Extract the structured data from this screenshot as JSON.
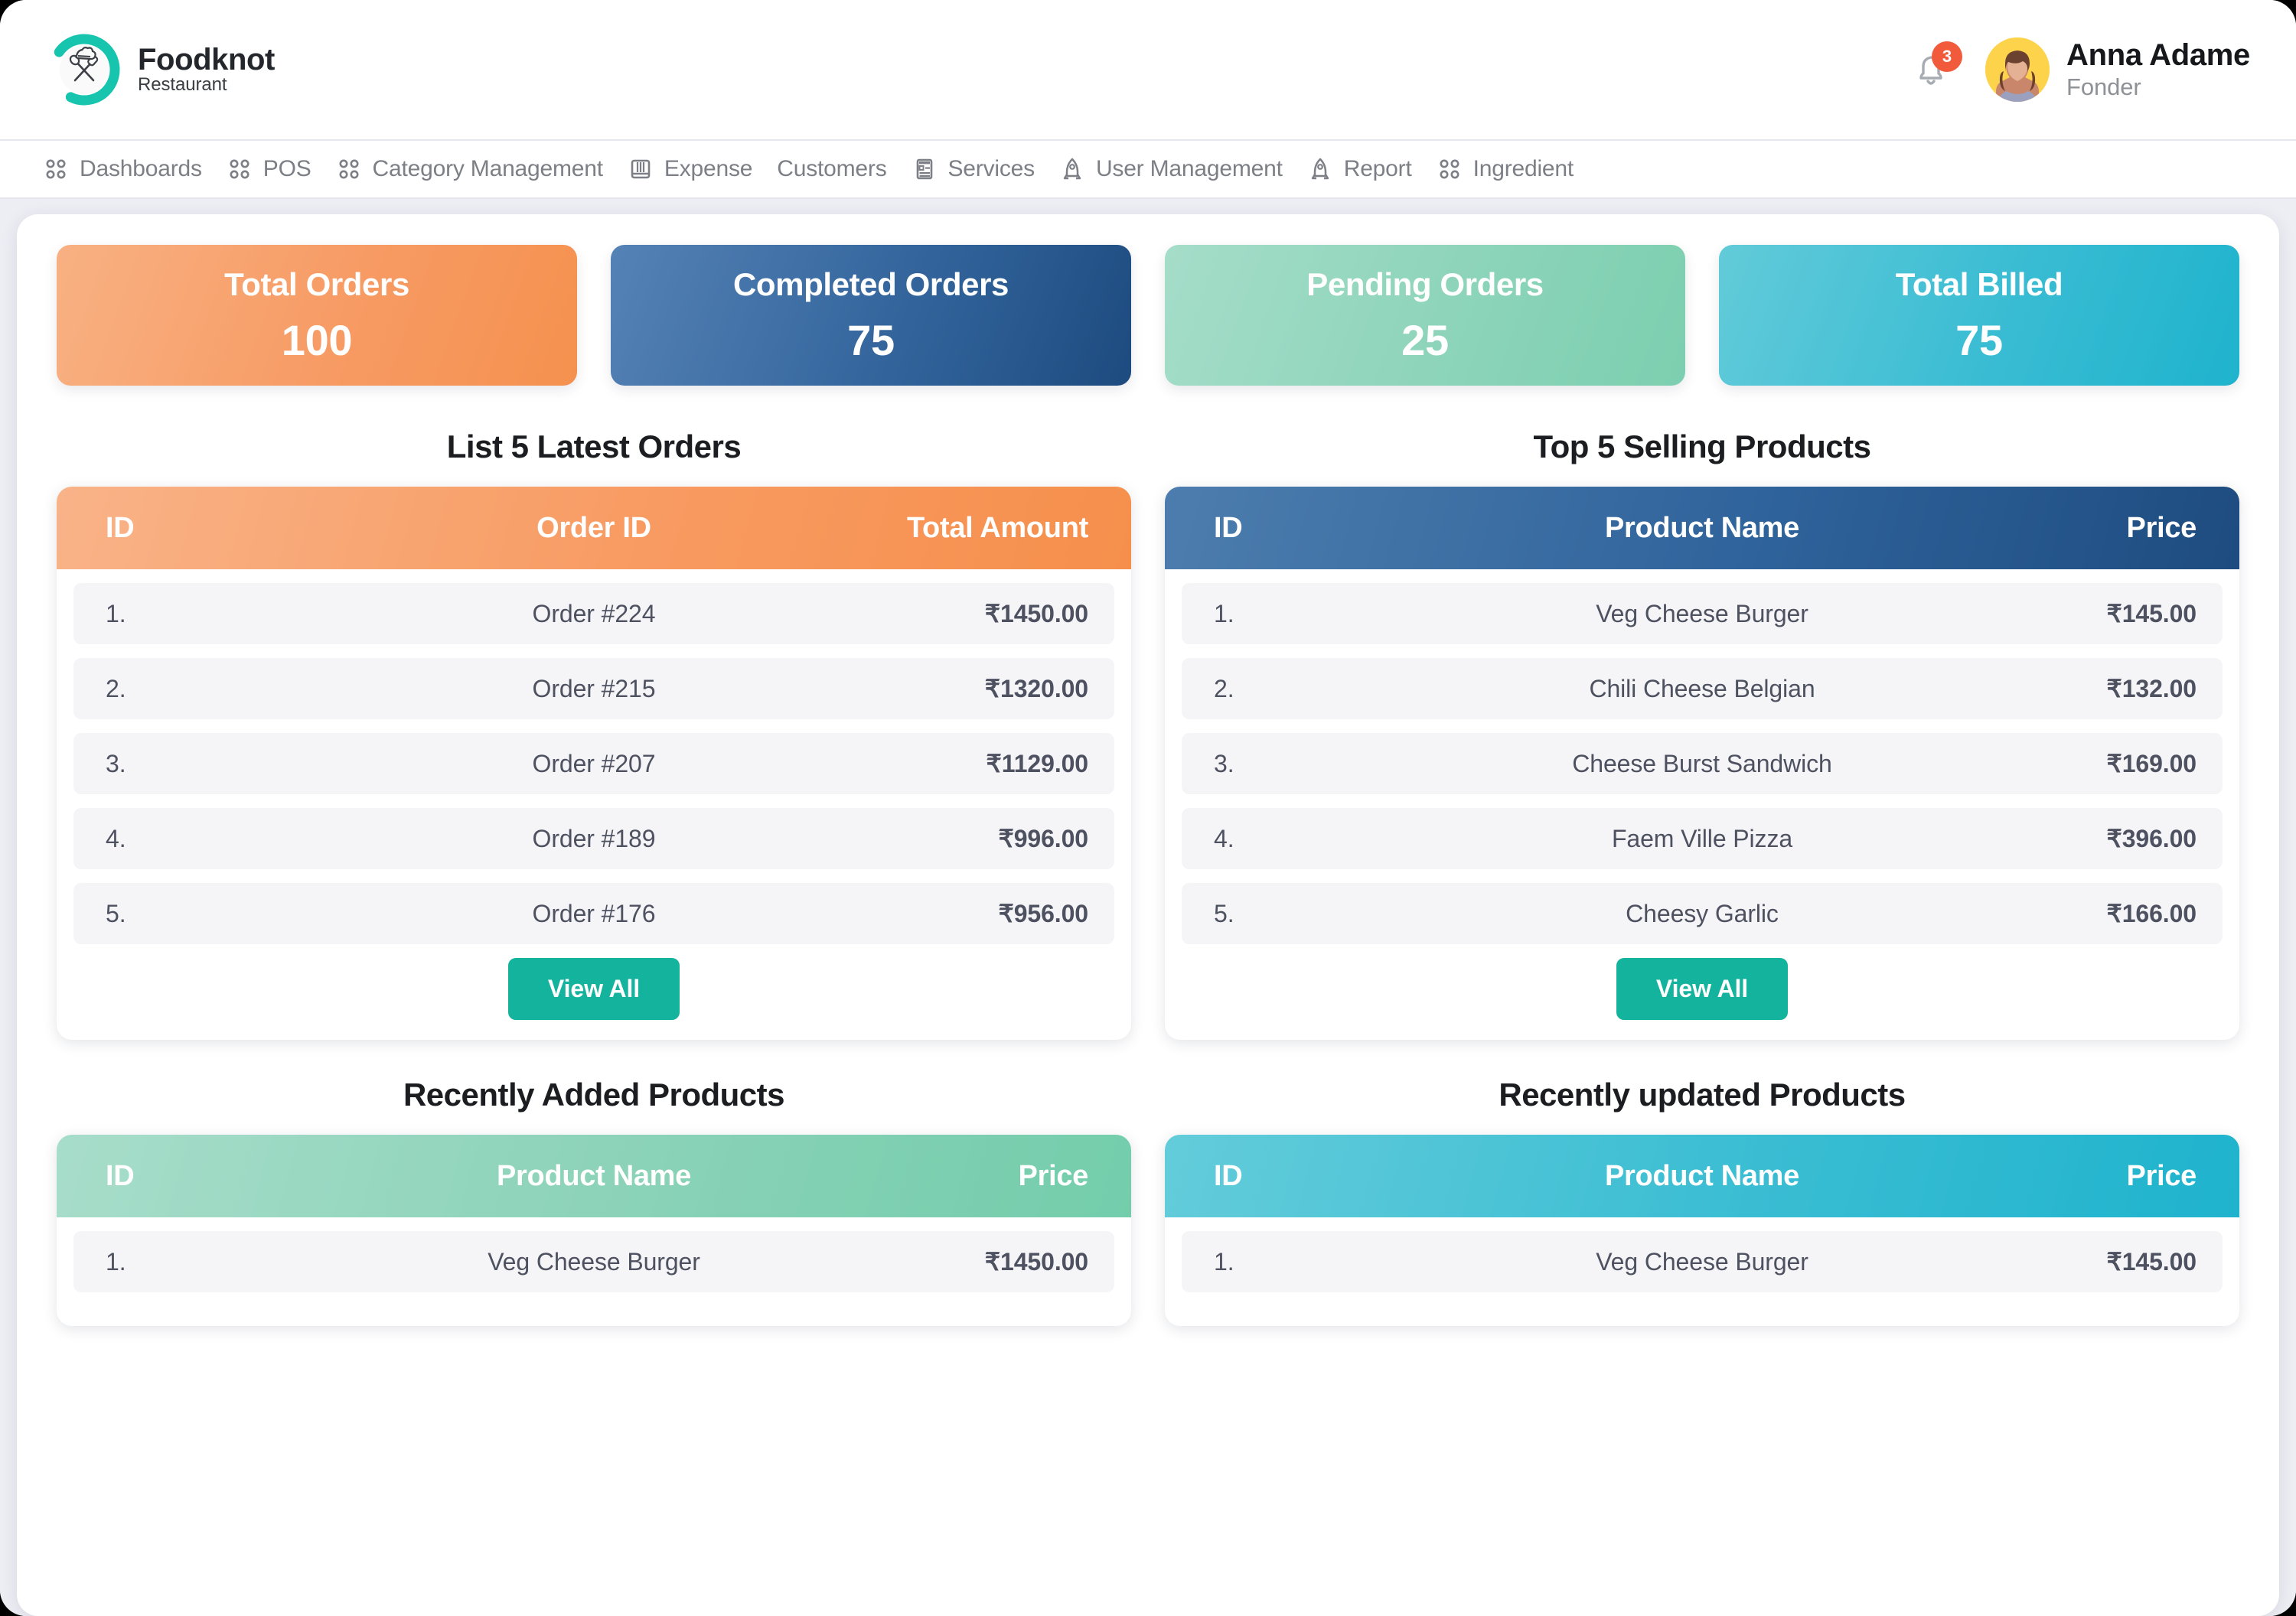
{
  "brand": {
    "title": "Foodknot",
    "subtitle": "Restaurant",
    "logo_icon": "chef-hat-spoon-fork-c-ring-logo"
  },
  "header": {
    "notifications_icon": "bell-icon",
    "notifications_count": "3",
    "avatar_icon": "user-avatar-photo",
    "user_name": "Anna Adame",
    "user_role": "Fonder"
  },
  "nav": {
    "items": [
      {
        "label": "Dashboards",
        "icon": "grid-dots-icon"
      },
      {
        "label": "POS",
        "icon": "grid-dots-icon"
      },
      {
        "label": "Category Management",
        "icon": "grid-dots-icon"
      },
      {
        "label": "Expense",
        "icon": "columns-layout-icon"
      },
      {
        "label": "Customers",
        "icon": "none"
      },
      {
        "label": "Services",
        "icon": "list-layout-icon"
      },
      {
        "label": "User Management",
        "icon": "rocket-icon"
      },
      {
        "label": "Report",
        "icon": "rocket-icon"
      },
      {
        "label": "Ingredient",
        "icon": "grid-dots-icon"
      }
    ]
  },
  "stats": [
    {
      "label": "Total Orders",
      "value": "100",
      "color": "#f5914f"
    },
    {
      "label": "Completed Orders",
      "value": "75",
      "color": "#1d4b80"
    },
    {
      "label": "Pending Orders",
      "value": "25",
      "color": "#7ccfb0"
    },
    {
      "label": "Total Billed",
      "value": "75",
      "color": "#1fb3cd"
    }
  ],
  "panels": {
    "latest_orders": {
      "title": "List 5 Latest Orders",
      "columns": [
        "ID",
        "Order ID",
        "Total Amount"
      ],
      "rows": [
        {
          "id": "1.",
          "name": "Order #224",
          "amount": "₹1450.00"
        },
        {
          "id": "2.",
          "name": "Order #215",
          "amount": "₹1320.00"
        },
        {
          "id": "3.",
          "name": "Order #207",
          "amount": "₹1129.00"
        },
        {
          "id": "4.",
          "name": "Order #189",
          "amount": "₹996.00"
        },
        {
          "id": "5.",
          "name": "Order #176",
          "amount": "₹956.00"
        }
      ],
      "view_all_label": "View All"
    },
    "top_selling": {
      "title": "Top 5 Selling Products",
      "columns": [
        "ID",
        "Product Name",
        "Price"
      ],
      "rows": [
        {
          "id": "1.",
          "name": "Veg Cheese Burger",
          "amount": "₹145.00"
        },
        {
          "id": "2.",
          "name": "Chili Cheese Belgian",
          "amount": "₹132.00"
        },
        {
          "id": "3.",
          "name": "Cheese Burst Sandwich",
          "amount": "₹169.00"
        },
        {
          "id": "4.",
          "name": "Faem Ville Pizza",
          "amount": "₹396.00"
        },
        {
          "id": "5.",
          "name": "Cheesy Garlic",
          "amount": "₹166.00"
        }
      ],
      "view_all_label": "View All"
    },
    "recently_added": {
      "title": "Recently Added Products",
      "columns": [
        "ID",
        "Product Name",
        "Price"
      ],
      "rows": [
        {
          "id": "1.",
          "name": "Veg Cheese Burger",
          "amount": "₹1450.00"
        }
      ]
    },
    "recently_updated": {
      "title": "Recently updated Products",
      "columns": [
        "ID",
        "Product Name",
        "Price"
      ],
      "rows": [
        {
          "id": "1.",
          "name": "Veg Cheese Burger",
          "amount": "₹145.00"
        }
      ]
    }
  }
}
